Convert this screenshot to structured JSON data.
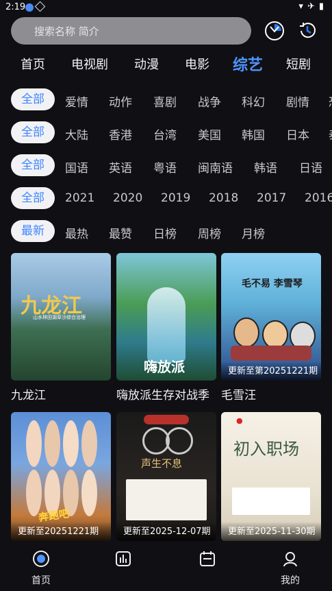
{
  "status_bar": {
    "time": "2:19"
  },
  "search": {
    "placeholder": "搜索名称 简介"
  },
  "nav_tabs": [
    "首页",
    "电视剧",
    "动漫",
    "电影",
    "综艺",
    "短剧"
  ],
  "filters": [
    {
      "selected": "全部",
      "options": [
        "爱情",
        "动作",
        "喜剧",
        "战争",
        "科幻",
        "剧情",
        "恐"
      ]
    },
    {
      "selected": "全部",
      "options": [
        "大陆",
        "香港",
        "台湾",
        "美国",
        "韩国",
        "日本",
        "泰"
      ]
    },
    {
      "selected": "全部",
      "options": [
        "国语",
        "英语",
        "粤语",
        "闽南语",
        "韩语",
        "日语"
      ]
    },
    {
      "selected": "全部",
      "options": [
        "2021",
        "2020",
        "2019",
        "2018",
        "2017",
        "2016"
      ]
    },
    {
      "selected": "最新",
      "options": [
        "最热",
        "最赞",
        "日榜",
        "周榜",
        "月榜"
      ]
    }
  ],
  "cards": [
    {
      "title": "九龙江",
      "badge": "",
      "poster_text": "九龙江",
      "poster_sub": "山水林田湖草沙综合治理"
    },
    {
      "title": "嗨放派生存对战季",
      "badge": "",
      "poster_text": "嗨放派"
    },
    {
      "title": "毛雪汪",
      "badge": "更新至第20251221期",
      "poster_text": "毛不易 李雪琴"
    },
    {
      "title": "",
      "badge": "更新至20251221期",
      "poster_text": "奔跑吧"
    },
    {
      "title": "",
      "badge": "更新至2025-12-07期",
      "poster_text": "声生不息"
    },
    {
      "title": "",
      "badge": "更新至2025-11-30期",
      "poster_text": "初入职场"
    }
  ],
  "bottom_nav": [
    {
      "label": "首页",
      "icon": "home-icon"
    },
    {
      "label": "",
      "icon": "chart-icon"
    },
    {
      "label": "",
      "icon": "calendar-icon"
    },
    {
      "label": "我的",
      "icon": "profile-icon"
    }
  ],
  "colors": {
    "accent": "#4f95ff",
    "chip_bg": "#f2f2f4",
    "background": "#101014",
    "search_bg": "#8e8e92"
  }
}
